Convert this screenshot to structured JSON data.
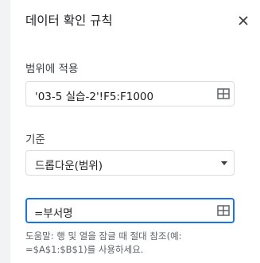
{
  "panel": {
    "title": "데이터 확인 규칙",
    "close_icon": "close-icon"
  },
  "range": {
    "label": "범위에 적용",
    "value": "'03-5 실습-2'!F5:F1000",
    "icon": "grid-select-icon"
  },
  "criteria": {
    "label": "기준",
    "selected": "드롭다운(범위)",
    "icon": "dropdown-arrow-icon"
  },
  "source": {
    "value": "=부서명",
    "icon": "grid-select-icon"
  },
  "help": {
    "line1": "도움말: 행 및 열을 잠글 때 절대 참조(예:",
    "line2": "=$A$1:$B$1)를 사용하세요."
  },
  "colors": {
    "accent": "#1a73e8",
    "border": "#dadce0",
    "text": "#202124",
    "muted": "#5f6368"
  }
}
